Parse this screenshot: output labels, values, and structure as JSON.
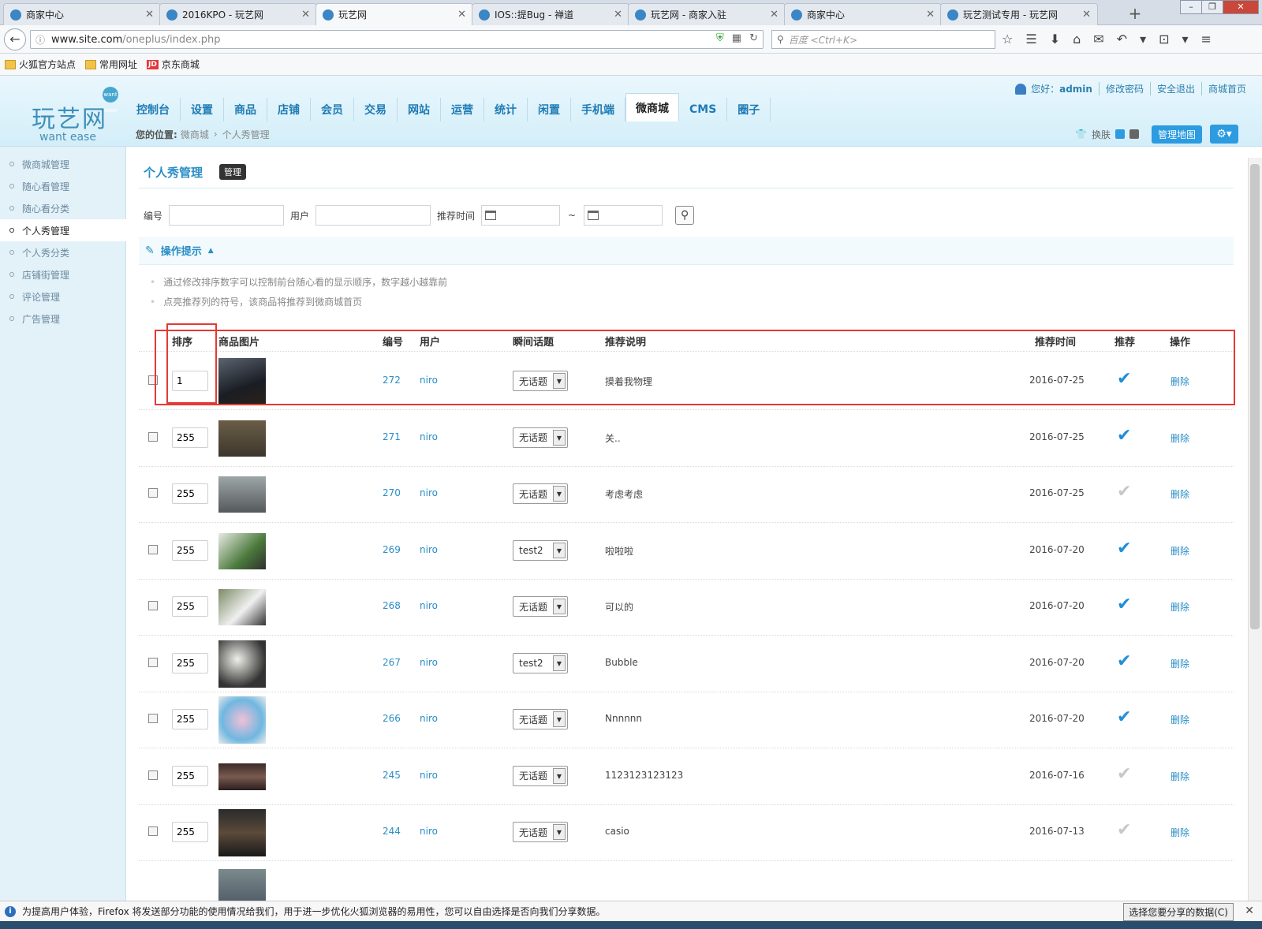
{
  "browser": {
    "tabs": [
      {
        "title": "商家中心",
        "active": false
      },
      {
        "title": "2016KPO - 玩艺网",
        "active": false
      },
      {
        "title": "玩艺网",
        "active": true
      },
      {
        "title": "IOS::提Bug - 禅道",
        "active": false
      },
      {
        "title": "玩艺网 - 商家入驻",
        "active": false
      },
      {
        "title": "商家中心",
        "active": false
      },
      {
        "title": "玩艺测试专用 - 玩艺网",
        "active": false
      }
    ],
    "new_tab": "+",
    "url_host": "www.site.com",
    "url_path": "/oneplus/index.php",
    "search_placeholder": "百度 <Ctrl+K>",
    "bookmarks": [
      {
        "label": "火狐官方站点",
        "icon": "folder-icon"
      },
      {
        "label": "常用网址",
        "icon": "folder-icon"
      },
      {
        "label": "京东商城",
        "icon": "jd-icon"
      }
    ],
    "jd_text": "JD",
    "notification": "为提高用户体验，Firefox 将发送部分功能的使用情况给我们，用于进一步优化火狐浏览器的易用性，您可以自由选择是否向我们分享数据。",
    "notification_button": "选择您要分享的数据(C)"
  },
  "app": {
    "logo_cn": "玩艺网",
    "logo_en": "want ease",
    "logo_badge": "want ease",
    "greeting": "您好：",
    "username": "admin",
    "top_links": [
      "修改密码",
      "安全退出",
      "商城首页"
    ],
    "nav": [
      "控制台",
      "设置",
      "商品",
      "店铺",
      "会员",
      "交易",
      "网站",
      "运营",
      "统计",
      "闲置",
      "手机端",
      "微商城",
      "CMS",
      "圈子"
    ],
    "nav_active": "微商城",
    "breadcrumb_label": "您的位置:",
    "breadcrumb": [
      "微商城",
      "个人秀管理"
    ],
    "skin_label": "换肤",
    "map_button": "管理地图",
    "sidebar": [
      "微商城管理",
      "随心看管理",
      "随心看分类",
      "个人秀管理",
      "个人秀分类",
      "店铺街管理",
      "评论管理",
      "广告管理"
    ],
    "sidebar_active": "个人秀管理"
  },
  "page": {
    "title": "个人秀管理",
    "title_badge": "管理",
    "filter": {
      "id_label": "编号",
      "user_label": "用户",
      "time_label": "推荐时间",
      "tilde": "~"
    },
    "tips_title": "操作提示",
    "tips": [
      "通过修改排序数字可以控制前台随心看的显示顺序，数字越小越靠前",
      "点亮推荐列的符号，该商品将推荐到微商城首页"
    ],
    "columns": {
      "sort": "排序",
      "image": "商品图片",
      "id": "编号",
      "user": "用户",
      "topic": "瞬间话题",
      "desc": "推荐说明",
      "time": "推荐时间",
      "recommend": "推荐",
      "action": "操作"
    },
    "rows": [
      {
        "sort": "1",
        "id": "272",
        "user": "niro",
        "topic": "无话题",
        "desc": "摸着我物理",
        "time": "2016-07-25",
        "recommended": true,
        "action": "删除"
      },
      {
        "sort": "255",
        "id": "271",
        "user": "niro",
        "topic": "无话题",
        "desc": "关..",
        "time": "2016-07-25",
        "recommended": true,
        "action": "删除"
      },
      {
        "sort": "255",
        "id": "270",
        "user": "niro",
        "topic": "无话题",
        "desc": "考虑考虑",
        "time": "2016-07-25",
        "recommended": false,
        "action": "删除"
      },
      {
        "sort": "255",
        "id": "269",
        "user": "niro",
        "topic": "test2",
        "desc": "啦啦啦",
        "time": "2016-07-20",
        "recommended": true,
        "action": "删除"
      },
      {
        "sort": "255",
        "id": "268",
        "user": "niro",
        "topic": "无话题",
        "desc": "可以的",
        "time": "2016-07-20",
        "recommended": true,
        "action": "删除"
      },
      {
        "sort": "255",
        "id": "267",
        "user": "niro",
        "topic": "test2",
        "desc": "Bubble",
        "time": "2016-07-20",
        "recommended": true,
        "action": "删除"
      },
      {
        "sort": "255",
        "id": "266",
        "user": "niro",
        "topic": "无话题",
        "desc": "Nnnnnn",
        "time": "2016-07-20",
        "recommended": true,
        "action": "删除"
      },
      {
        "sort": "255",
        "id": "245",
        "user": "niro",
        "topic": "无话题",
        "desc": "1123123123123",
        "time": "2016-07-16",
        "recommended": false,
        "action": "删除"
      },
      {
        "sort": "255",
        "id": "244",
        "user": "niro",
        "topic": "无话题",
        "desc": "casio",
        "time": "2016-07-13",
        "recommended": false,
        "action": "删除"
      }
    ]
  },
  "colors": {
    "accent": "#2a8ec6",
    "check_on": "#1f8ed9",
    "check_off": "#c8c8c8",
    "annotation": "#e53935"
  }
}
